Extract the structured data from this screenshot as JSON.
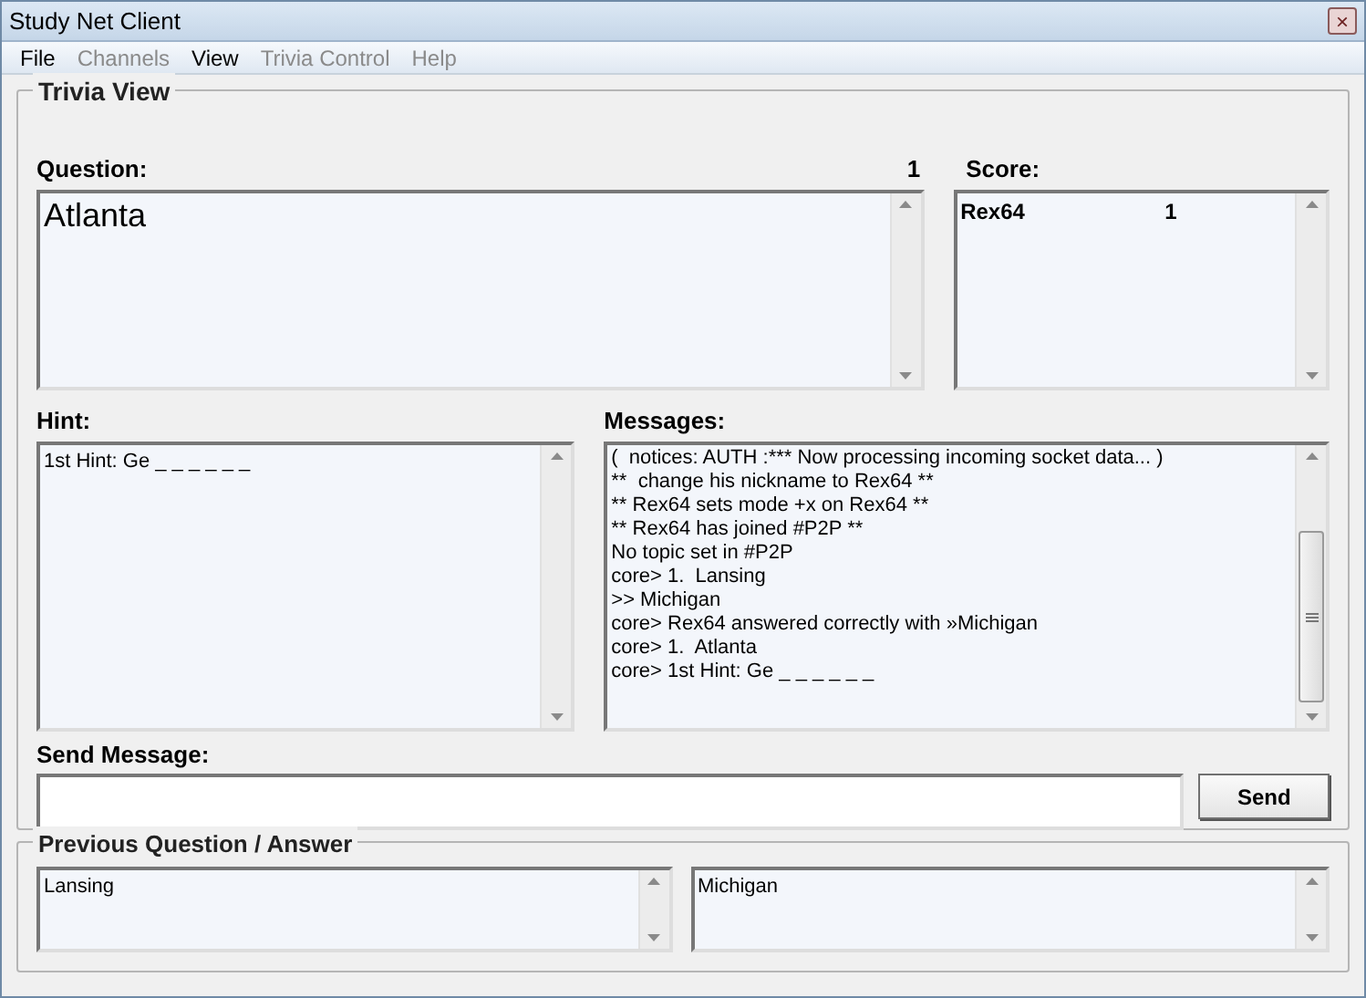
{
  "window": {
    "title": "Study Net Client",
    "close": "×"
  },
  "menu": [
    {
      "label": "File",
      "disabled": false
    },
    {
      "label": "Channels",
      "disabled": true
    },
    {
      "label": "View",
      "disabled": false
    },
    {
      "label": "Trivia Control",
      "disabled": true
    },
    {
      "label": "Help",
      "disabled": true
    }
  ],
  "trivia_view": {
    "title": "Trivia View",
    "question": {
      "label": "Question:",
      "number": "1",
      "text": "Atlanta"
    },
    "score": {
      "label": "Score:",
      "rows": [
        {
          "name": "Rex64",
          "points": "1"
        }
      ]
    },
    "hint": {
      "label": "Hint:",
      "text": "1st Hint: Ge _ _ _ _ _ _"
    },
    "messages": {
      "label": "Messages:",
      "lines": [
        "(  notices: AUTH :*** Now processing incoming socket data... )",
        "**  change his nickname to Rex64 **",
        "** Rex64 sets mode +x on Rex64 **",
        "** Rex64 has joined #P2P **",
        "No topic set in #P2P",
        "core> 1.  Lansing",
        ">> Michigan",
        "core> Rex64 answered correctly with »Michigan",
        "core> 1.  Atlanta",
        "core> 1st Hint: Ge _ _ _ _ _ _"
      ]
    },
    "send_message": {
      "label": "Send Message:",
      "button": "Send"
    }
  },
  "previous": {
    "title": "Previous Question / Answer",
    "question": "Lansing",
    "answer": "Michigan"
  }
}
